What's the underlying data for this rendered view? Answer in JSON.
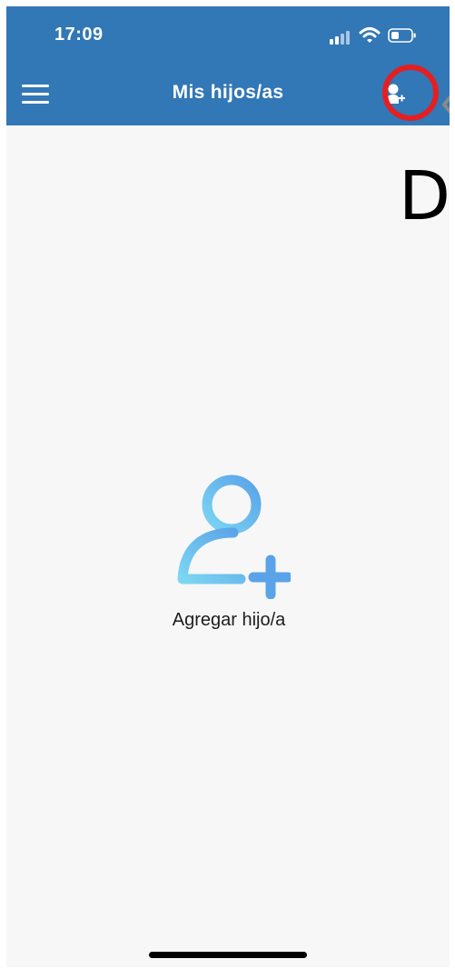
{
  "status_bar": {
    "time": "17:09"
  },
  "header": {
    "title": "Mis hijos/as",
    "menu_icon": "hamburger-menu-icon",
    "action_icon": "add-user-icon"
  },
  "annotation": {
    "partial_text": "Da"
  },
  "main": {
    "add_child_label": "Agregar hijo/a",
    "add_child_icon": "add-person-icon"
  },
  "colors": {
    "header_bg": "#3277b6",
    "page_bg": "#f7f7f7",
    "highlight": "#e41f22",
    "icon_gradient_start": "#7cd6f2",
    "icon_gradient_end": "#5aa3e8"
  }
}
